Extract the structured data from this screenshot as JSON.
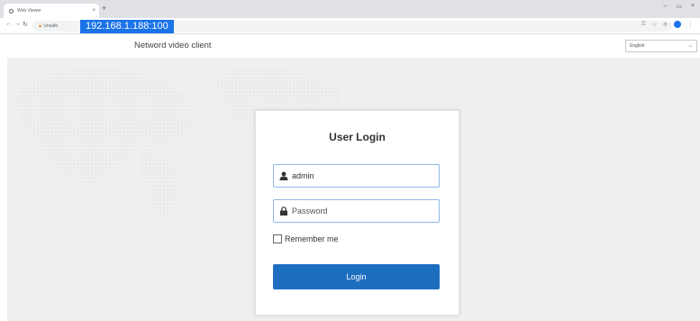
{
  "browser": {
    "tab_title": "Web Viewer",
    "tab_close": "×",
    "new_tab": "+",
    "security_label": "Unsafe",
    "url": "192.168.1.188:100",
    "window_controls": [
      "–",
      "▭",
      "×"
    ]
  },
  "header": {
    "title": "Netword video client",
    "language": "English"
  },
  "login": {
    "title": "User Login",
    "username_value": "admin",
    "password_placeholder": "Password",
    "remember_label": "Remember me",
    "remember_checked": false,
    "login_button": "Login"
  },
  "colors": {
    "primary": "#1e6ec0",
    "url_highlight": "#1a73e8",
    "background": "#efefef"
  }
}
